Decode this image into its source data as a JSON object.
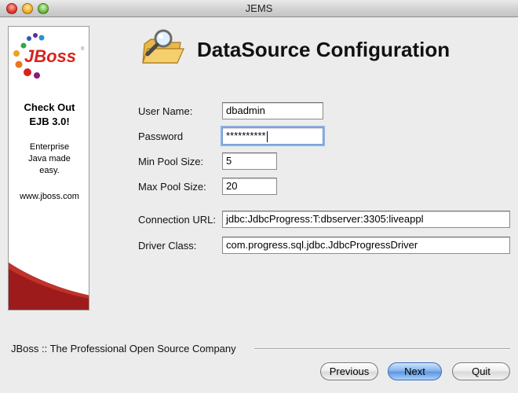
{
  "window": {
    "title": "JEMS"
  },
  "sidebar_ad": {
    "logo_text": "JBoss",
    "headline_line1": "Check Out",
    "headline_line2": "EJB 3.0!",
    "body_line1": "Enterprise",
    "body_line2": "Java made",
    "body_line3": "easy.",
    "url": "www.jboss.com",
    "colors": {
      "logo_red": "#d7231f",
      "accent_dark_red": "#9e1b1b"
    }
  },
  "header": {
    "title": "DataSource Configuration",
    "icon": "folder-magnifier-icon"
  },
  "form": {
    "user_name": {
      "label": "User Name:",
      "value": "dbadmin"
    },
    "password": {
      "label": "Password",
      "value": "**********"
    },
    "min_pool_size": {
      "label": "Min Pool Size:",
      "value": "5"
    },
    "max_pool_size": {
      "label": "Max Pool Size:",
      "value": "20"
    },
    "connection_url": {
      "label": "Connection URL:",
      "value": "jdbc:JdbcProgress:T:dbserver:3305:liveappl"
    },
    "driver_class": {
      "label": "Driver Class:",
      "value": "com.progress.sql.jdbc.JdbcProgressDriver"
    }
  },
  "footer": {
    "company": "JBoss :: The Professional Open Source Company",
    "buttons": {
      "previous": "Previous",
      "next": "Next",
      "quit": "Quit"
    }
  }
}
